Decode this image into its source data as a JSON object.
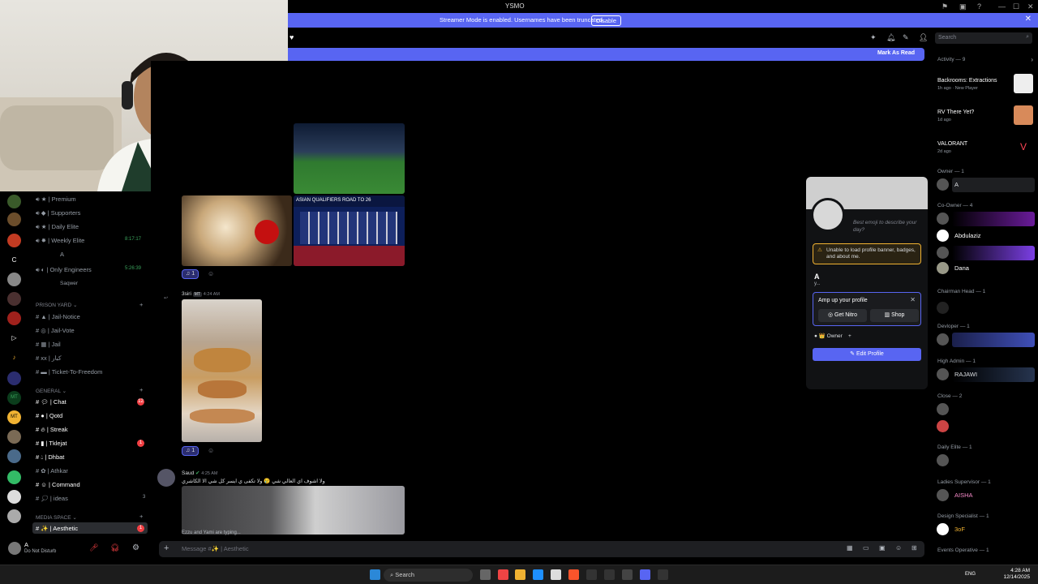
{
  "window": {
    "title": "YSMO"
  },
  "streamer": {
    "message": "Streamer Mode is enabled. Usernames have been truncated.",
    "disable_label": "Disable"
  },
  "header": {
    "search_placeholder": "Search",
    "mark_as_read": "Mark As Read"
  },
  "rail_labels": [
    "C",
    "MT",
    "MT"
  ],
  "channels": {
    "top": [
      {
        "label": "Premium",
        "time": ""
      },
      {
        "label": "Supporters",
        "time": ""
      },
      {
        "label": "Daily Elite",
        "time": ""
      },
      {
        "label": "Weekly Elite",
        "time": "8:17:17"
      },
      {
        "label": "A",
        "time": ""
      },
      {
        "label": "Only Engineers",
        "time": "5:26:39"
      },
      {
        "label": "Saqwer",
        "time": ""
      }
    ],
    "prison_yard": "PRISON YARD",
    "prison": [
      "Jail-Notice",
      "Jail-Vote",
      "Jail",
      "ﻛﺒﺎﺭ",
      "Ticket-To-Freedom"
    ],
    "general_label": "GENERAL",
    "general": [
      {
        "label": "Chat",
        "badge": "12"
      },
      {
        "label": "Qotd",
        "badge": ""
      },
      {
        "label": "Streak",
        "badge": ""
      },
      {
        "label": "Tklejat",
        "badge": "1"
      },
      {
        "label": "Dhbat",
        "badge": ""
      },
      {
        "label": "Athkar",
        "badge": ""
      },
      {
        "label": "Command",
        "badge": ""
      },
      {
        "label": "ideas",
        "badge": "3"
      }
    ],
    "media_label": "MEDIA SPACE",
    "media": [
      {
        "label": "Aesthetic",
        "badge": "1"
      }
    ]
  },
  "user": {
    "name": "A",
    "status": "Do Not Disturb"
  },
  "messages": {
    "reaction_count": "1",
    "msg2_author": "3siri",
    "msg2_tag": "MT",
    "msg2_time": "4:24 AM",
    "msg3_author": "Saud",
    "msg3_time": "4:25 AM",
    "msg3_text": "ولا اشوف اي العالي شي 😢 ولا تكفى ي ايسر كل شي الا الكاشري",
    "typing": "Ezzu and Yami are typing...",
    "composer_placeholder": "Message #✨ | Aesthetic",
    "stadium_caption": "ASIAN QUALIFIERS ROAD TO 26"
  },
  "profile": {
    "status_placeholder": "Best emoji to describe your day?",
    "warning": "Unable to load profile banner, badges, and about me.",
    "name": "A",
    "sub": "y...",
    "amp_title": "Amp up your profile",
    "get_nitro": "Get Nitro",
    "shop": "Shop",
    "role": "Owner",
    "edit": "Edit Profile"
  },
  "sidebar": {
    "activity_label": "Activity — 9",
    "activities": [
      {
        "title": "Backrooms: Extractions",
        "sub": "1h ago · New Player",
        "color": "#eeeeee"
      },
      {
        "title": "RV There Yet?",
        "sub": "1d ago",
        "color": "#d88a5a"
      },
      {
        "title": "VALORANT",
        "sub": "2d ago",
        "color": "#000000"
      }
    ],
    "groups": [
      {
        "head": "Owner — 1",
        "members": [
          {
            "name": "A",
            "color": "#dbdee1",
            "bg": ""
          }
        ]
      },
      {
        "head": "Co-Owner — 4",
        "members": [
          {
            "name": "",
            "color": "#c770f0",
            "bg": "#6a1b9a"
          },
          {
            "name": "Abdulaziz",
            "color": "#ffffff",
            "bg": ""
          },
          {
            "name": "",
            "color": "#c770f0",
            "bg": "#7b3fe4"
          },
          {
            "name": "Dana",
            "color": "#ffffff",
            "bg": ""
          }
        ]
      },
      {
        "head": "Chairman Head — 1",
        "members": [
          {
            "name": "",
            "color": "#dbdee1",
            "bg": ""
          }
        ]
      },
      {
        "head": "Devloper — 1",
        "members": [
          {
            "name": "",
            "color": "#ffffff",
            "bg": "#3f4fb8"
          }
        ]
      },
      {
        "head": "High Admin — 1",
        "members": [
          {
            "name": "RAJAWI",
            "color": "#dbdee1",
            "bg": "#26344f"
          }
        ]
      },
      {
        "head": "Close — 2",
        "members": [
          {
            "name": "",
            "color": "#dbdee1",
            "bg": ""
          },
          {
            "name": "",
            "color": "#dbdee1",
            "bg": ""
          }
        ]
      },
      {
        "head": "Daily Elite — 1",
        "members": [
          {
            "name": "",
            "color": "#dbdee1",
            "bg": ""
          }
        ]
      },
      {
        "head": "Ladies Supervisor — 1",
        "members": [
          {
            "name": "AISHA",
            "color": "#f58ac8",
            "bg": ""
          }
        ]
      },
      {
        "head": "Design Specialist — 1",
        "members": [
          {
            "name": "3oF",
            "color": "#f0b232",
            "bg": ""
          }
        ]
      },
      {
        "head": "Events Operative — 1",
        "members": [
          {
            "name": "YASIN",
            "color": "#dbdee1",
            "bg": ""
          }
        ]
      }
    ]
  },
  "taskbar": {
    "search": "Search",
    "lang": "ENG",
    "time": "4:28 AM",
    "date": "12/14/2025"
  },
  "colors": {
    "accent": "#5865f2",
    "danger": "#f23f43",
    "bg": "#000000"
  }
}
